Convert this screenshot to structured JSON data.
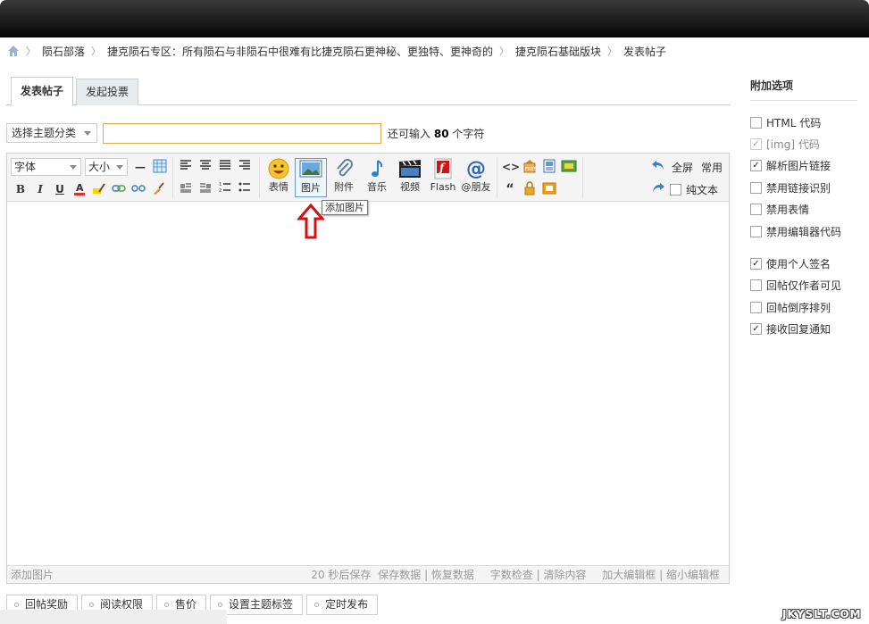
{
  "breadcrumb": {
    "items": [
      "陨石部落",
      "捷克陨石专区：所有陨石与非陨石中很难有比捷克陨石更神秘、更独特、更神奇的",
      "捷克陨石基础版块",
      "发表帖子"
    ]
  },
  "tabs": [
    {
      "label": "发表帖子"
    },
    {
      "label": "发起投票"
    }
  ],
  "form": {
    "type_select": "选择主题分类",
    "subject_value": "",
    "remain_prefix": "还可输入",
    "remain_count": "80",
    "remain_suffix": "个字符"
  },
  "toolbar": {
    "font_select": "字体",
    "size_select": "大小",
    "bold": "B",
    "italic": "I",
    "underline": "U",
    "buttons": [
      {
        "label": "表情"
      },
      {
        "label": "图片"
      },
      {
        "label": "附件"
      },
      {
        "label": "音乐"
      },
      {
        "label": "视频"
      },
      {
        "label": "Flash"
      },
      {
        "label": "@朋友"
      }
    ],
    "fullscreen": "全屏",
    "common": "常用",
    "plaintext": "纯文本",
    "tooltip": "添加图片"
  },
  "status": {
    "left": "添加图片",
    "autosave": "20 秒后保存",
    "save": "保存数据",
    "restore": "恢复数据",
    "check": "字数检查",
    "clear": "清除内容",
    "enlarge": "加大编辑框",
    "shrink": "缩小编辑框"
  },
  "bottom": [
    "回帖奖励",
    "阅读权限",
    "售价",
    "设置主题标签",
    "定时发布"
  ],
  "sidebar": {
    "title": "附加选项",
    "options": [
      {
        "label": "HTML 代码",
        "checked": false,
        "disabled": false
      },
      {
        "label": "[img] 代码",
        "checked": true,
        "disabled": true
      },
      {
        "label": "解析图片链接",
        "checked": true,
        "disabled": false
      },
      {
        "label": "禁用链接识别",
        "checked": false,
        "disabled": false
      },
      {
        "label": "禁用表情",
        "checked": false,
        "disabled": false
      },
      {
        "label": "禁用编辑器代码",
        "checked": false,
        "disabled": false
      }
    ],
    "options2": [
      {
        "label": "使用个人签名",
        "checked": true
      },
      {
        "label": "回帖仅作者可见",
        "checked": false
      },
      {
        "label": "回帖倒序排列",
        "checked": false
      },
      {
        "label": "接收回复通知",
        "checked": true
      }
    ]
  },
  "watermark": "JKYSLT.COM"
}
